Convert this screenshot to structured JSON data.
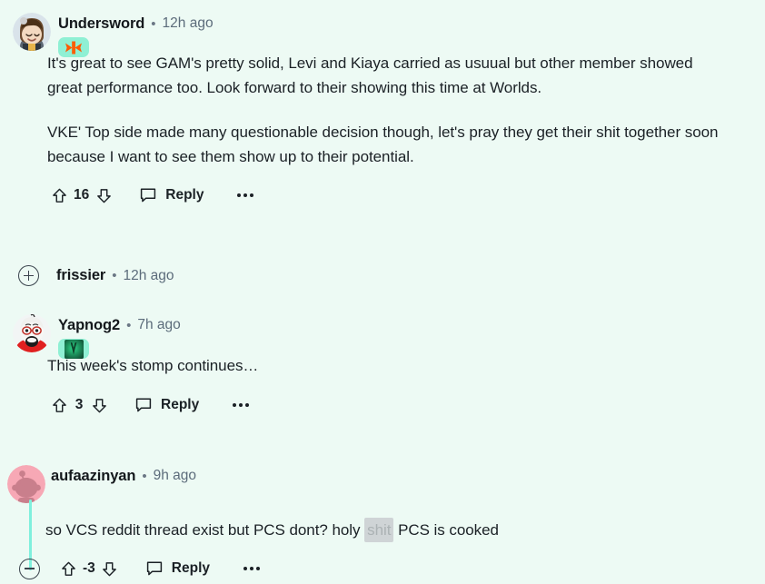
{
  "page": {
    "background_color": "#edfaf4",
    "thread_line_color": "#7ff0dd",
    "accent_flair_bg": "#8ff0d4"
  },
  "comments": [
    {
      "id": "undersword",
      "username": "Undersword",
      "separator": "•",
      "timestamp": "12h ago",
      "avatar_name": "avatar-undersword",
      "flair_name": "flair-fnatic",
      "flair_kind": "fnatic-logo",
      "collapsed": false,
      "paragraphs": [
        "It's great to see GAM's pretty solid, Levi and Kiaya carried as usuual but other member showed great performance too. Look forward to their showing this time at Worlds.",
        "VKE' Top side made many questionable decision though, let's pray they get their shit together soon because I want to see them show up to their potential."
      ],
      "score": "16",
      "reply_label": "Reply"
    },
    {
      "id": "frissier",
      "username": "frissier",
      "separator": "•",
      "timestamp": "12h ago",
      "collapsed": true
    },
    {
      "id": "yapnog2",
      "username": "Yapnog2",
      "separator": "•",
      "timestamp": "7h ago",
      "avatar_name": "avatar-yapnog2",
      "flair_name": "flair-team-image",
      "flair_kind": "green-image",
      "collapsed": false,
      "paragraphs": [
        "This week's stomp continues…"
      ],
      "score": "3",
      "reply_label": "Reply"
    },
    {
      "id": "aufaazinyan",
      "username": "aufaazinyan",
      "separator": "•",
      "timestamp": "9h ago",
      "avatar_name": "avatar-aufaazinyan",
      "collapsed": false,
      "text_before_spoiler": "so VCS reddit thread exist but PCS dont? holy ",
      "spoiler_text": "shit",
      "text_after_spoiler": " PCS is cooked",
      "score": "-3",
      "reply_label": "Reply"
    }
  ]
}
